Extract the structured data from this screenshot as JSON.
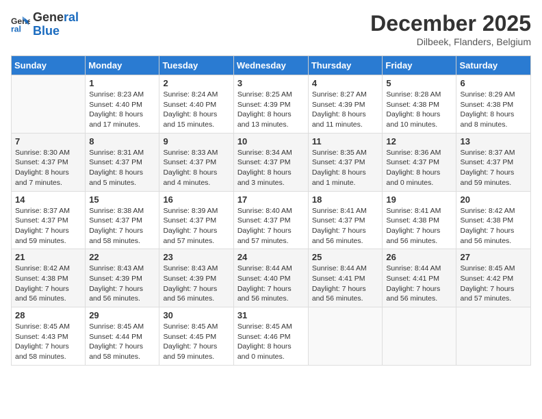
{
  "header": {
    "logo_line1": "General",
    "logo_line2": "Blue",
    "month": "December 2025",
    "location": "Dilbeek, Flanders, Belgium"
  },
  "columns": [
    "Sunday",
    "Monday",
    "Tuesday",
    "Wednesday",
    "Thursday",
    "Friday",
    "Saturday"
  ],
  "weeks": [
    [
      {
        "day": "",
        "sunrise": "",
        "sunset": "",
        "daylight": ""
      },
      {
        "day": "1",
        "sunrise": "Sunrise: 8:23 AM",
        "sunset": "Sunset: 4:40 PM",
        "daylight": "Daylight: 8 hours and 17 minutes."
      },
      {
        "day": "2",
        "sunrise": "Sunrise: 8:24 AM",
        "sunset": "Sunset: 4:40 PM",
        "daylight": "Daylight: 8 hours and 15 minutes."
      },
      {
        "day": "3",
        "sunrise": "Sunrise: 8:25 AM",
        "sunset": "Sunset: 4:39 PM",
        "daylight": "Daylight: 8 hours and 13 minutes."
      },
      {
        "day": "4",
        "sunrise": "Sunrise: 8:27 AM",
        "sunset": "Sunset: 4:39 PM",
        "daylight": "Daylight: 8 hours and 11 minutes."
      },
      {
        "day": "5",
        "sunrise": "Sunrise: 8:28 AM",
        "sunset": "Sunset: 4:38 PM",
        "daylight": "Daylight: 8 hours and 10 minutes."
      },
      {
        "day": "6",
        "sunrise": "Sunrise: 8:29 AM",
        "sunset": "Sunset: 4:38 PM",
        "daylight": "Daylight: 8 hours and 8 minutes."
      }
    ],
    [
      {
        "day": "7",
        "sunrise": "Sunrise: 8:30 AM",
        "sunset": "Sunset: 4:37 PM",
        "daylight": "Daylight: 8 hours and 7 minutes."
      },
      {
        "day": "8",
        "sunrise": "Sunrise: 8:31 AM",
        "sunset": "Sunset: 4:37 PM",
        "daylight": "Daylight: 8 hours and 5 minutes."
      },
      {
        "day": "9",
        "sunrise": "Sunrise: 8:33 AM",
        "sunset": "Sunset: 4:37 PM",
        "daylight": "Daylight: 8 hours and 4 minutes."
      },
      {
        "day": "10",
        "sunrise": "Sunrise: 8:34 AM",
        "sunset": "Sunset: 4:37 PM",
        "daylight": "Daylight: 8 hours and 3 minutes."
      },
      {
        "day": "11",
        "sunrise": "Sunrise: 8:35 AM",
        "sunset": "Sunset: 4:37 PM",
        "daylight": "Daylight: 8 hours and 1 minute."
      },
      {
        "day": "12",
        "sunrise": "Sunrise: 8:36 AM",
        "sunset": "Sunset: 4:37 PM",
        "daylight": "Daylight: 8 hours and 0 minutes."
      },
      {
        "day": "13",
        "sunrise": "Sunrise: 8:37 AM",
        "sunset": "Sunset: 4:37 PM",
        "daylight": "Daylight: 7 hours and 59 minutes."
      }
    ],
    [
      {
        "day": "14",
        "sunrise": "Sunrise: 8:37 AM",
        "sunset": "Sunset: 4:37 PM",
        "daylight": "Daylight: 7 hours and 59 minutes."
      },
      {
        "day": "15",
        "sunrise": "Sunrise: 8:38 AM",
        "sunset": "Sunset: 4:37 PM",
        "daylight": "Daylight: 7 hours and 58 minutes."
      },
      {
        "day": "16",
        "sunrise": "Sunrise: 8:39 AM",
        "sunset": "Sunset: 4:37 PM",
        "daylight": "Daylight: 7 hours and 57 minutes."
      },
      {
        "day": "17",
        "sunrise": "Sunrise: 8:40 AM",
        "sunset": "Sunset: 4:37 PM",
        "daylight": "Daylight: 7 hours and 57 minutes."
      },
      {
        "day": "18",
        "sunrise": "Sunrise: 8:41 AM",
        "sunset": "Sunset: 4:37 PM",
        "daylight": "Daylight: 7 hours and 56 minutes."
      },
      {
        "day": "19",
        "sunrise": "Sunrise: 8:41 AM",
        "sunset": "Sunset: 4:38 PM",
        "daylight": "Daylight: 7 hours and 56 minutes."
      },
      {
        "day": "20",
        "sunrise": "Sunrise: 8:42 AM",
        "sunset": "Sunset: 4:38 PM",
        "daylight": "Daylight: 7 hours and 56 minutes."
      }
    ],
    [
      {
        "day": "21",
        "sunrise": "Sunrise: 8:42 AM",
        "sunset": "Sunset: 4:38 PM",
        "daylight": "Daylight: 7 hours and 56 minutes."
      },
      {
        "day": "22",
        "sunrise": "Sunrise: 8:43 AM",
        "sunset": "Sunset: 4:39 PM",
        "daylight": "Daylight: 7 hours and 56 minutes."
      },
      {
        "day": "23",
        "sunrise": "Sunrise: 8:43 AM",
        "sunset": "Sunset: 4:39 PM",
        "daylight": "Daylight: 7 hours and 56 minutes."
      },
      {
        "day": "24",
        "sunrise": "Sunrise: 8:44 AM",
        "sunset": "Sunset: 4:40 PM",
        "daylight": "Daylight: 7 hours and 56 minutes."
      },
      {
        "day": "25",
        "sunrise": "Sunrise: 8:44 AM",
        "sunset": "Sunset: 4:41 PM",
        "daylight": "Daylight: 7 hours and 56 minutes."
      },
      {
        "day": "26",
        "sunrise": "Sunrise: 8:44 AM",
        "sunset": "Sunset: 4:41 PM",
        "daylight": "Daylight: 7 hours and 56 minutes."
      },
      {
        "day": "27",
        "sunrise": "Sunrise: 8:45 AM",
        "sunset": "Sunset: 4:42 PM",
        "daylight": "Daylight: 7 hours and 57 minutes."
      }
    ],
    [
      {
        "day": "28",
        "sunrise": "Sunrise: 8:45 AM",
        "sunset": "Sunset: 4:43 PM",
        "daylight": "Daylight: 7 hours and 58 minutes."
      },
      {
        "day": "29",
        "sunrise": "Sunrise: 8:45 AM",
        "sunset": "Sunset: 4:44 PM",
        "daylight": "Daylight: 7 hours and 58 minutes."
      },
      {
        "day": "30",
        "sunrise": "Sunrise: 8:45 AM",
        "sunset": "Sunset: 4:45 PM",
        "daylight": "Daylight: 7 hours and 59 minutes."
      },
      {
        "day": "31",
        "sunrise": "Sunrise: 8:45 AM",
        "sunset": "Sunset: 4:46 PM",
        "daylight": "Daylight: 8 hours and 0 minutes."
      },
      {
        "day": "",
        "sunrise": "",
        "sunset": "",
        "daylight": ""
      },
      {
        "day": "",
        "sunrise": "",
        "sunset": "",
        "daylight": ""
      },
      {
        "day": "",
        "sunrise": "",
        "sunset": "",
        "daylight": ""
      }
    ]
  ]
}
